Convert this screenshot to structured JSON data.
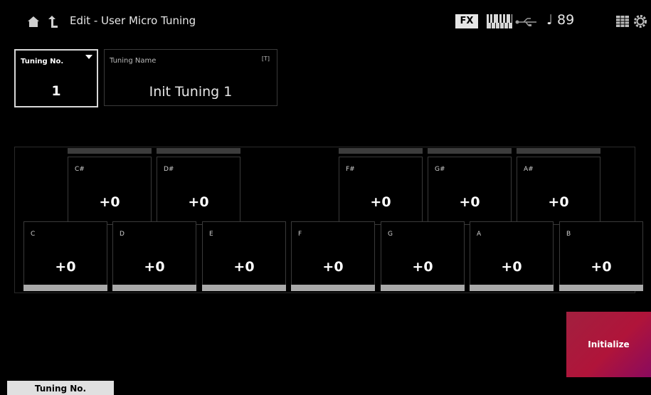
{
  "header": {
    "title": "Edit - User Micro Tuning",
    "fx_label": "FX",
    "tempo": "♩ 89",
    "icons": [
      "home-icon",
      "up-arrow-icon",
      "keyboard-icon",
      "usb-icon",
      "grid-icon",
      "settings-icon"
    ]
  },
  "tuning_no": {
    "label": "Tuning No.",
    "value": "1"
  },
  "tuning_name": {
    "label": "Tuning Name",
    "keyboard_hint": "[T]",
    "value": "Init Tuning 1"
  },
  "black_keys": [
    {
      "name": "C#",
      "value": "+0"
    },
    {
      "name": "D#",
      "value": "+0"
    },
    {
      "name": "F#",
      "value": "+0"
    },
    {
      "name": "G#",
      "value": "+0"
    },
    {
      "name": "A#",
      "value": "+0"
    }
  ],
  "white_keys": [
    {
      "name": "C",
      "value": "+0"
    },
    {
      "name": "D",
      "value": "+0"
    },
    {
      "name": "E",
      "value": "+0"
    },
    {
      "name": "F",
      "value": "+0"
    },
    {
      "name": "G",
      "value": "+0"
    },
    {
      "name": "A",
      "value": "+0"
    },
    {
      "name": "B",
      "value": "+0"
    }
  ],
  "initialize_button": {
    "label": "Initialize",
    "color": "#b0143a"
  },
  "bottom_tab": {
    "label": "Tuning No."
  }
}
